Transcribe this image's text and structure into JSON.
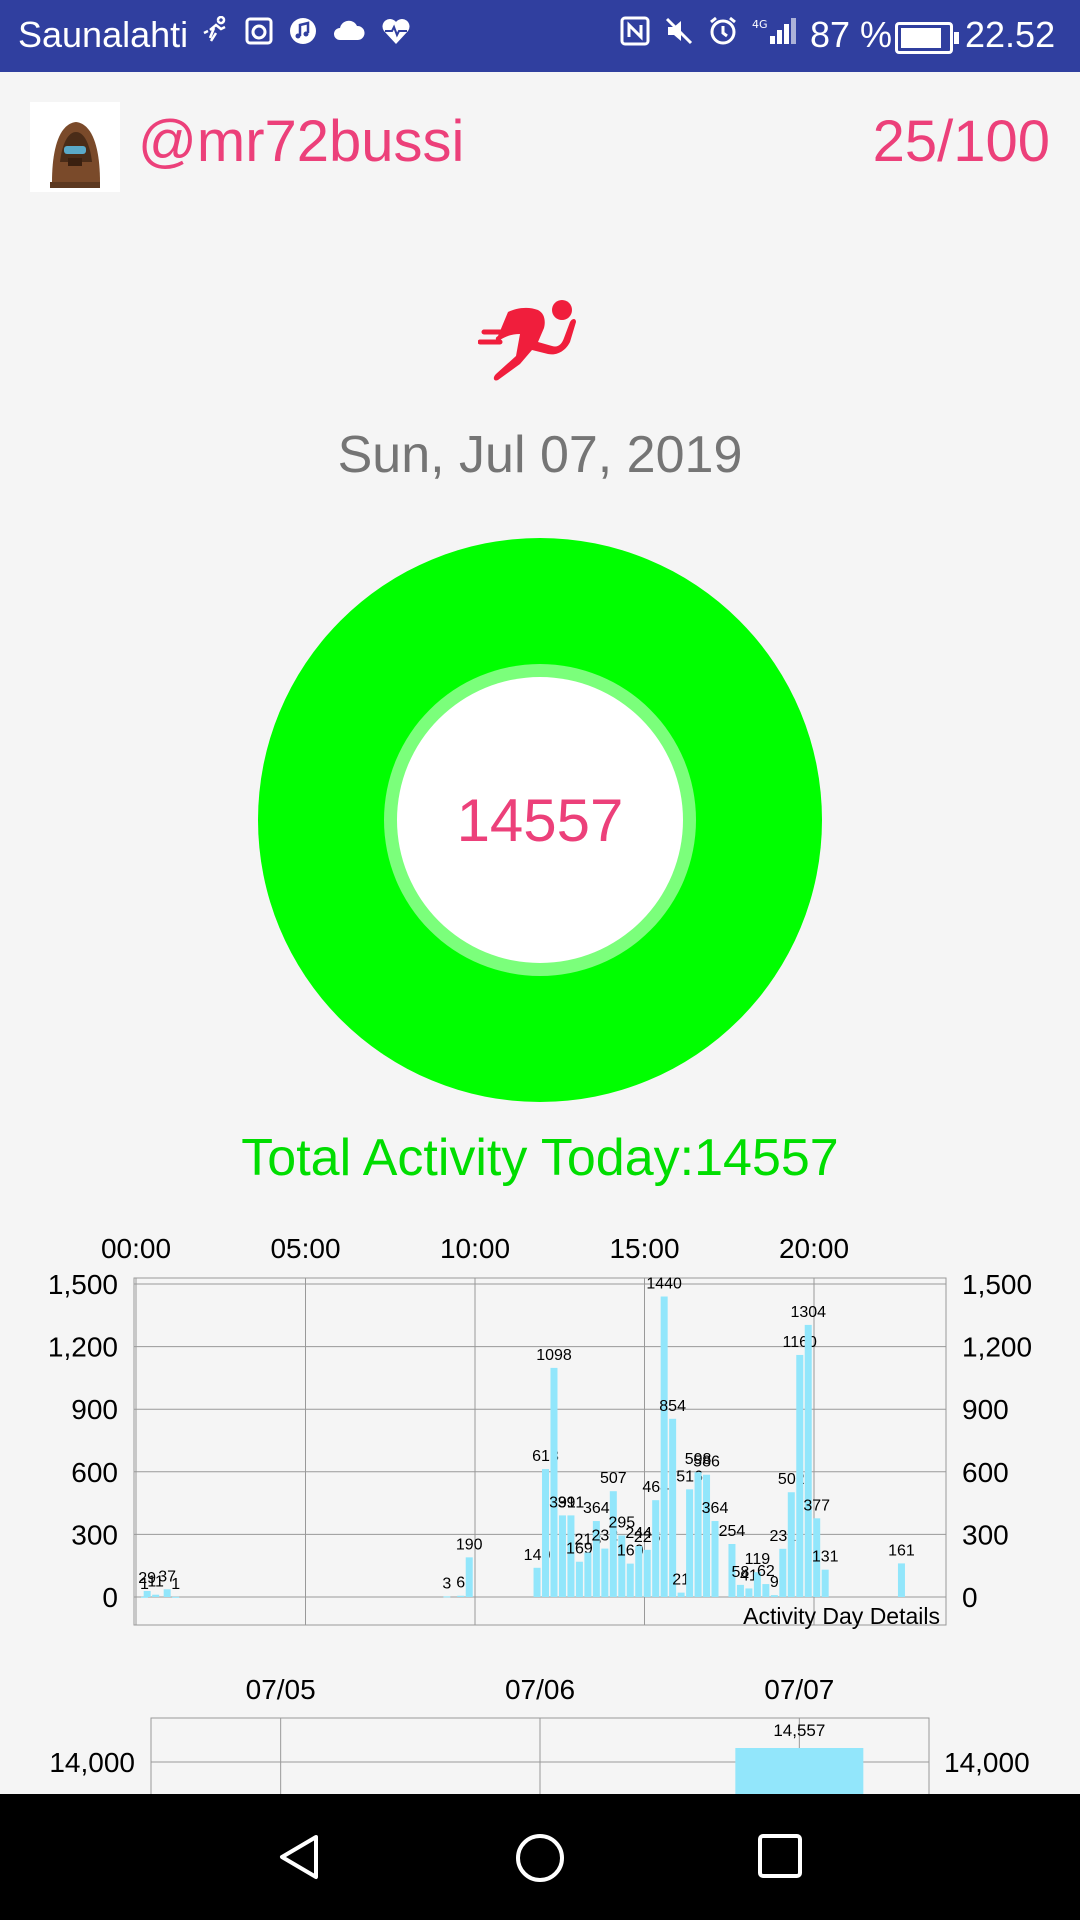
{
  "status_bar": {
    "carrier": "Saunalahti",
    "left_icons": [
      "running-icon",
      "washer-icon",
      "music-icon",
      "cloud-icon",
      "heartbeat-icon"
    ],
    "right_icons": [
      "nfc-icon",
      "mute-icon",
      "alarm-icon",
      "signal-4g-icon"
    ],
    "battery_pct": "87 %",
    "battery_level": 0.87,
    "time": "22.52"
  },
  "header": {
    "username": "@mr72bussi",
    "score": "25/100"
  },
  "date": "Sun, Jul 07, 2019",
  "ring": {
    "value": "14557",
    "progress": 1.0
  },
  "total_activity": "Total Activity Today:14557",
  "colors": {
    "accent_pink": "#ec407a",
    "ring_green": "#00ff00",
    "bar_blue": "#92e6fb",
    "status_bar": "#303f9f"
  },
  "chart_data": [
    {
      "type": "bar",
      "description_label": "Activity Day Details",
      "x_tick_labels": [
        "00:00",
        "05:00",
        "10:00",
        "15:00",
        "20:00"
      ],
      "y_tick_labels": [
        "0",
        "300",
        "600",
        "900",
        "1,200",
        "1,500"
      ],
      "ylim": [
        0,
        1500
      ],
      "xlim_hours": [
        0,
        24
      ],
      "grid": true,
      "bars": [
        {
          "x": 0.25,
          "y": 1
        },
        {
          "x": 0.33,
          "y": 29
        },
        {
          "x": 0.58,
          "y": 11
        },
        {
          "x": 0.92,
          "y": 37
        },
        {
          "x": 1.17,
          "y": 1
        },
        {
          "x": 9.17,
          "y": 3
        },
        {
          "x": 9.58,
          "y": 6
        },
        {
          "x": 9.83,
          "y": 190
        },
        {
          "x": 11.83,
          "y": 140
        },
        {
          "x": 12.08,
          "y": 613
        },
        {
          "x": 12.33,
          "y": 1098
        },
        {
          "x": 12.58,
          "y": 391
        },
        {
          "x": 12.83,
          "y": 391
        },
        {
          "x": 13.08,
          "y": 169
        },
        {
          "x": 13.33,
          "y": 213
        },
        {
          "x": 13.58,
          "y": 364
        },
        {
          "x": 13.83,
          "y": 232
        },
        {
          "x": 14.08,
          "y": 507
        },
        {
          "x": 14.33,
          "y": 295
        },
        {
          "x": 14.58,
          "y": 160
        },
        {
          "x": 14.83,
          "y": 244
        },
        {
          "x": 15.08,
          "y": 226
        },
        {
          "x": 15.33,
          "y": 464
        },
        {
          "x": 15.58,
          "y": 1440
        },
        {
          "x": 15.83,
          "y": 854
        },
        {
          "x": 16.08,
          "y": 21
        },
        {
          "x": 16.33,
          "y": 516
        },
        {
          "x": 16.58,
          "y": 598
        },
        {
          "x": 16.83,
          "y": 586
        },
        {
          "x": 17.08,
          "y": 364
        },
        {
          "x": 17.58,
          "y": 254
        },
        {
          "x": 17.83,
          "y": 58
        },
        {
          "x": 18.08,
          "y": 41
        },
        {
          "x": 18.33,
          "y": 119
        },
        {
          "x": 18.58,
          "y": 62
        },
        {
          "x": 18.83,
          "y": 9
        },
        {
          "x": 19.08,
          "y": 231
        },
        {
          "x": 19.33,
          "y": 502
        },
        {
          "x": 19.58,
          "y": 1160
        },
        {
          "x": 19.83,
          "y": 1304
        },
        {
          "x": 20.08,
          "y": 377
        },
        {
          "x": 20.33,
          "y": 131
        },
        {
          "x": 22.58,
          "y": 161
        }
      ]
    },
    {
      "type": "bar",
      "x_tick_labels": [
        "07/05",
        "07/06",
        "07/07"
      ],
      "y_tick_labels": [
        "14,000"
      ],
      "ylim": [
        0,
        15000
      ],
      "grid": true,
      "bars": [
        {
          "x": "07/07",
          "y": 14557,
          "label": "14,557"
        }
      ]
    }
  ]
}
